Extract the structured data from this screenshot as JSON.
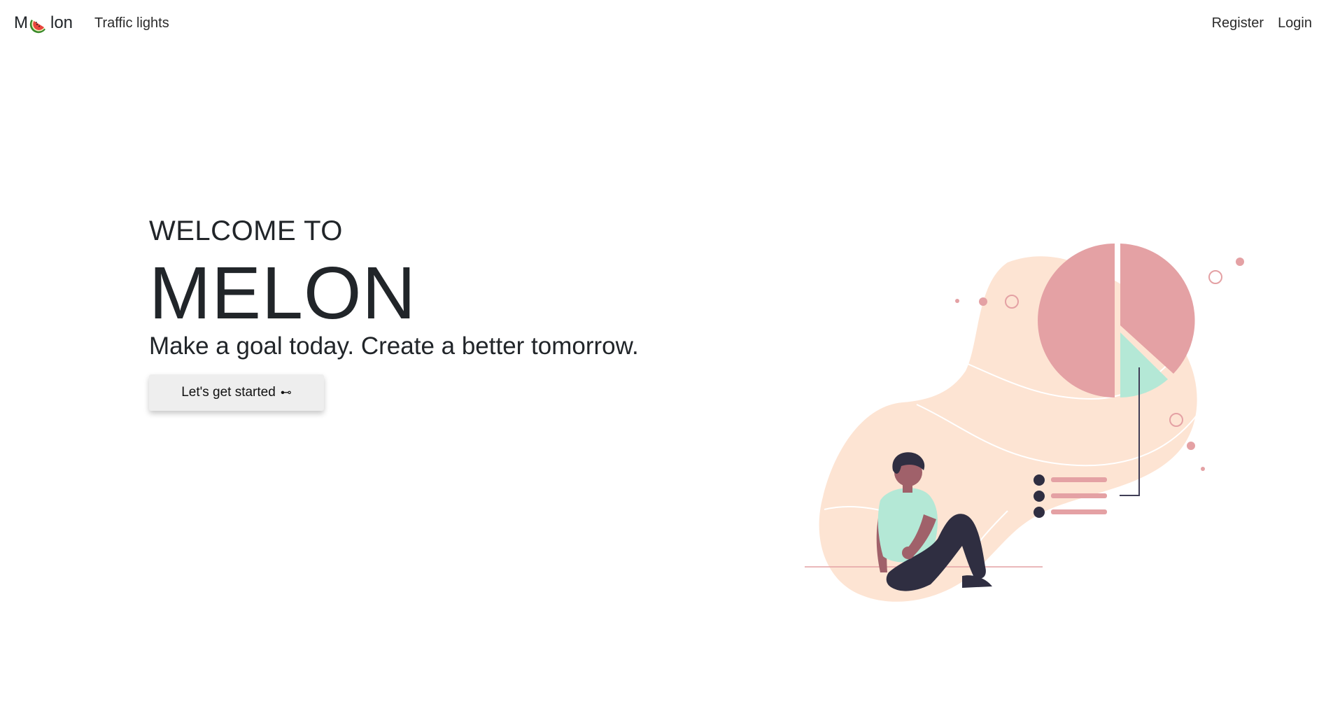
{
  "navbar": {
    "brand_left": "M",
    "brand_right": "lon",
    "brand_icon": "watermelon-icon",
    "links_left": [
      "Traffic lights"
    ],
    "links_right": [
      "Register",
      "Login"
    ]
  },
  "hero": {
    "welcome": "WELCOME TO",
    "title": "MELON",
    "tagline": "Make a goal today. Create a better tomorrow.",
    "cta_label": "Let's get started",
    "cta_icon": "arrow-right-icon",
    "cta_arrow_glyph": "⊷"
  },
  "illustration": {
    "name": "person-with-pie-chart-illustration",
    "colors": {
      "blob": "#fde4d3",
      "pie": "#e4a1a4",
      "pie_slice": "#b4e8d6",
      "dark": "#2f2e41",
      "skin": "#a0616a",
      "shirt": "#b4e8d6"
    }
  }
}
